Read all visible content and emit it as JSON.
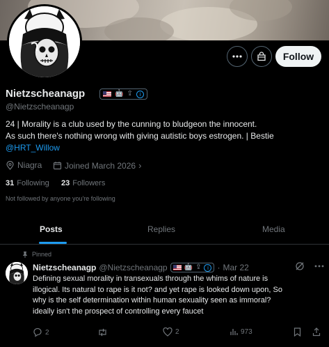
{
  "profile": {
    "display_name": "Nietzscheanagp",
    "handle": "@Nietzscheanagp",
    "bio_lines": [
      "24 | Morality is a club used by the cunning to bludgeon the innocent.",
      "As such there's nothing wrong with giving autistic boys estrogen. | Bestie"
    ],
    "bio_mention": "@HRT_Willow",
    "location": "Niagra",
    "joined": "Joined March 2026",
    "following_count": "31",
    "following_label": "Following",
    "followers_count": "23",
    "followers_label": "Followers",
    "not_followed_text": "Not followed by anyone you're following"
  },
  "actions": {
    "follow_label": "Follow",
    "more_icon": "more-horizontal-icon",
    "subscribe_icon": "gift-bag-icon"
  },
  "tabs": [
    {
      "label": "Posts",
      "active": true
    },
    {
      "label": "Replies",
      "active": false
    },
    {
      "label": "Media",
      "active": false
    }
  ],
  "pinned_post": {
    "pinned_label": "Pinned",
    "author_name": "Nietzscheanagp",
    "author_handle": "@Nietzscheanagp",
    "separator": "·",
    "date": "Mar 22",
    "text_lines": [
      "Defining sexual morality in transexuals through the whims of nature is",
      "illogical. Its natural to rape is it not? and yet rape is looked down upon, So",
      "why is the self determination within human sexuality seen as immoral?",
      "ideally isn't the prospect of controlling every faucet"
    ],
    "reply_count": "2",
    "repost_count": "",
    "like_count": "2",
    "view_count": "973"
  },
  "colors": {
    "background": "#000000",
    "text": "#e7e9ea",
    "muted": "#71767b",
    "accent": "#1d9bf0",
    "border": "#2f3336"
  }
}
